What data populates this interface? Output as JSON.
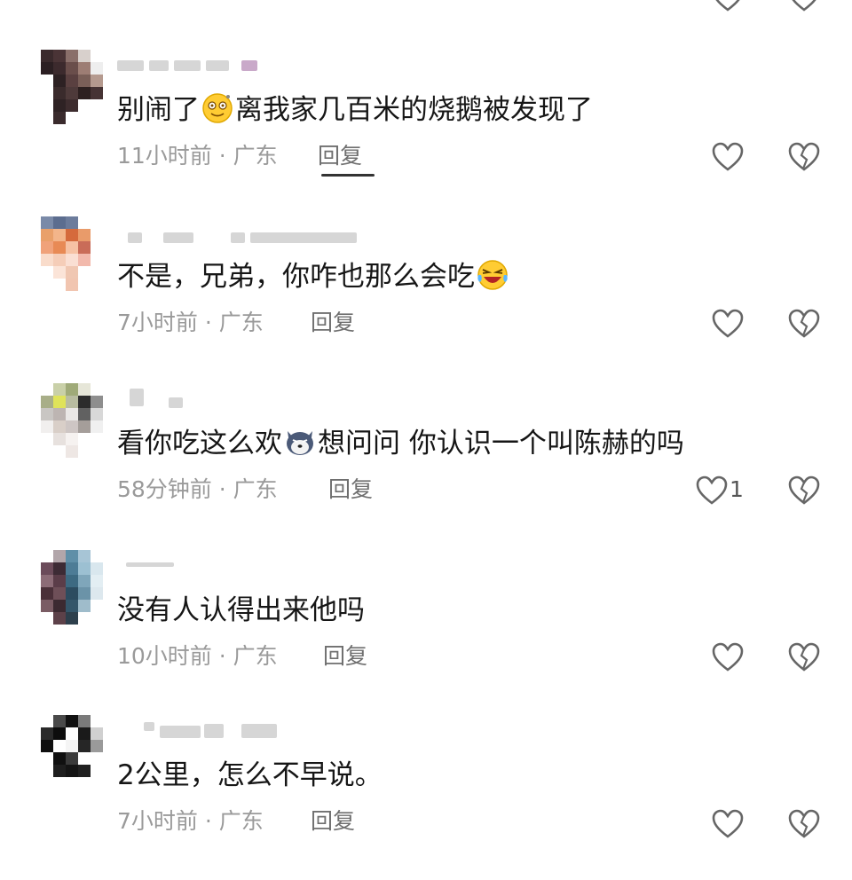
{
  "comments": [
    {
      "text_before": "别闹了",
      "emoji": "dizzy-smile-emoji",
      "text_after": "离我家几百米的烧鹅被发现了",
      "time": "11小时前",
      "location": "广东",
      "reply_label": "回复"
    },
    {
      "text_before": "不是，兄弟，你咋也那么会吃",
      "emoji": "laugh-crying-emoji",
      "text_after": "",
      "time": "7小时前",
      "location": "广东",
      "reply_label": "回复"
    },
    {
      "text_before": "看你吃这么欢",
      "emoji": "husky-dog-emoji",
      "text_after": "想问问 你认识一个叫陈赫的吗",
      "time": "58分钟前",
      "location": "广东",
      "reply_label": "回复",
      "like_count": "1"
    },
    {
      "text_before": "没有人认得出来他吗",
      "emoji": "",
      "text_after": "",
      "time": "10小时前",
      "location": "广东",
      "reply_label": "回复"
    },
    {
      "text_before": "2公里，怎么不早说。",
      "emoji": "",
      "text_after": "",
      "time": "7小时前",
      "location": "广东",
      "reply_label": "回复"
    }
  ],
  "separator": " · ",
  "colors": {
    "text": "#161616",
    "meta": "#9a9a9a",
    "icon": "#666666"
  }
}
